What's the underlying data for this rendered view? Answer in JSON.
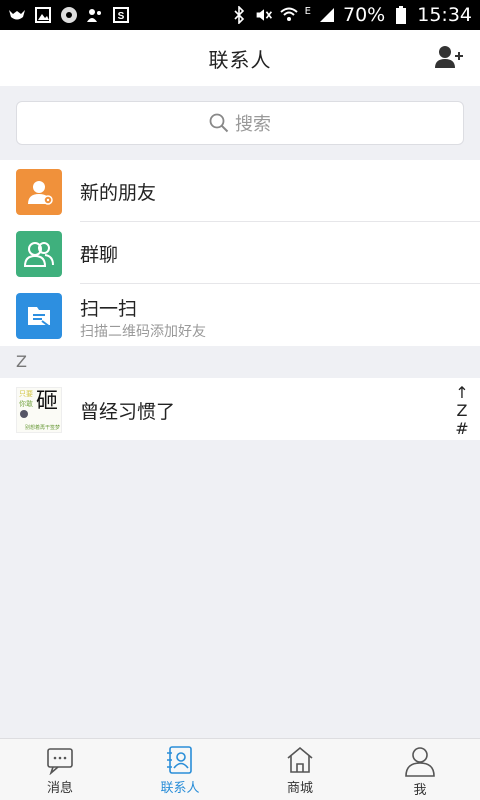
{
  "status_bar": {
    "battery_percent": "70%",
    "time": "15:34",
    "network_type": "E",
    "left_icons": [
      "cat-icon",
      "image-icon",
      "chrome-icon",
      "contacts-icon",
      "file-icon"
    ],
    "right_icons": [
      "bluetooth-icon",
      "mute-icon",
      "wifi-icon",
      "signal-icon",
      "battery-icon"
    ]
  },
  "header": {
    "title": "联系人",
    "add_contact_icon": "add-user-icon"
  },
  "search": {
    "placeholder": "搜索"
  },
  "menu": [
    {
      "label": "新的朋友",
      "icon": "new-friend-icon",
      "color": "#f0913b"
    },
    {
      "label": "群聊",
      "icon": "group-chat-icon",
      "color": "#3fb07d"
    },
    {
      "label": "扫一扫",
      "sublabel": "扫描二维码添加好友",
      "icon": "scan-icon",
      "color": "#2d8fe0"
    }
  ],
  "section": {
    "letter": "Z"
  },
  "contacts": [
    {
      "name": "曾经习惯了",
      "avatar_text": {
        "line1": "只要",
        "line2": "你敢",
        "big": "砸",
        "line3": "别想着再干签梦"
      }
    }
  ],
  "index_bar": [
    "↑",
    "Z",
    "#"
  ],
  "tabbar": {
    "tabs": [
      {
        "label": "消息",
        "icon": "message-icon",
        "active": false
      },
      {
        "label": "联系人",
        "icon": "contacts-book-icon",
        "active": true
      },
      {
        "label": "商城",
        "icon": "store-icon",
        "active": false
      },
      {
        "label": "我",
        "icon": "profile-icon",
        "active": false
      }
    ],
    "active_color": "#2a8ed8"
  }
}
